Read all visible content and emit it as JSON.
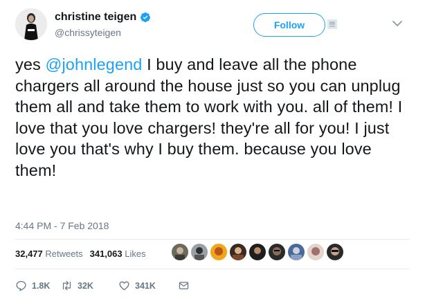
{
  "author": {
    "display_name": "christine teigen",
    "handle": "@chrissyteigen",
    "verified": true,
    "avatar_icon": "profile-photo"
  },
  "follow_button": {
    "label": "Follow"
  },
  "tweet": {
    "mention": "@johnlegend",
    "text_before_mention": "yes ",
    "text_after_mention": " I buy and leave all the phone chargers all around the house just so you can unplug them all and take them to work with you. all of them! I love that you love chargers! they're all for you! I just love you that's why I buy them. because you love them!",
    "timestamp": "4:44 PM - 7 Feb 2018"
  },
  "stats": {
    "retweets_count": "32,477",
    "retweets_label": "Retweets",
    "likes_count": "341,063",
    "likes_label": "Likes"
  },
  "actions": {
    "reply_count": "1.8K",
    "retweet_count": "32K",
    "like_count": "341K"
  },
  "colors": {
    "accent": "#1da1f2",
    "text": "#14171a",
    "secondary": "#657786",
    "divider": "#e6ecf0"
  }
}
